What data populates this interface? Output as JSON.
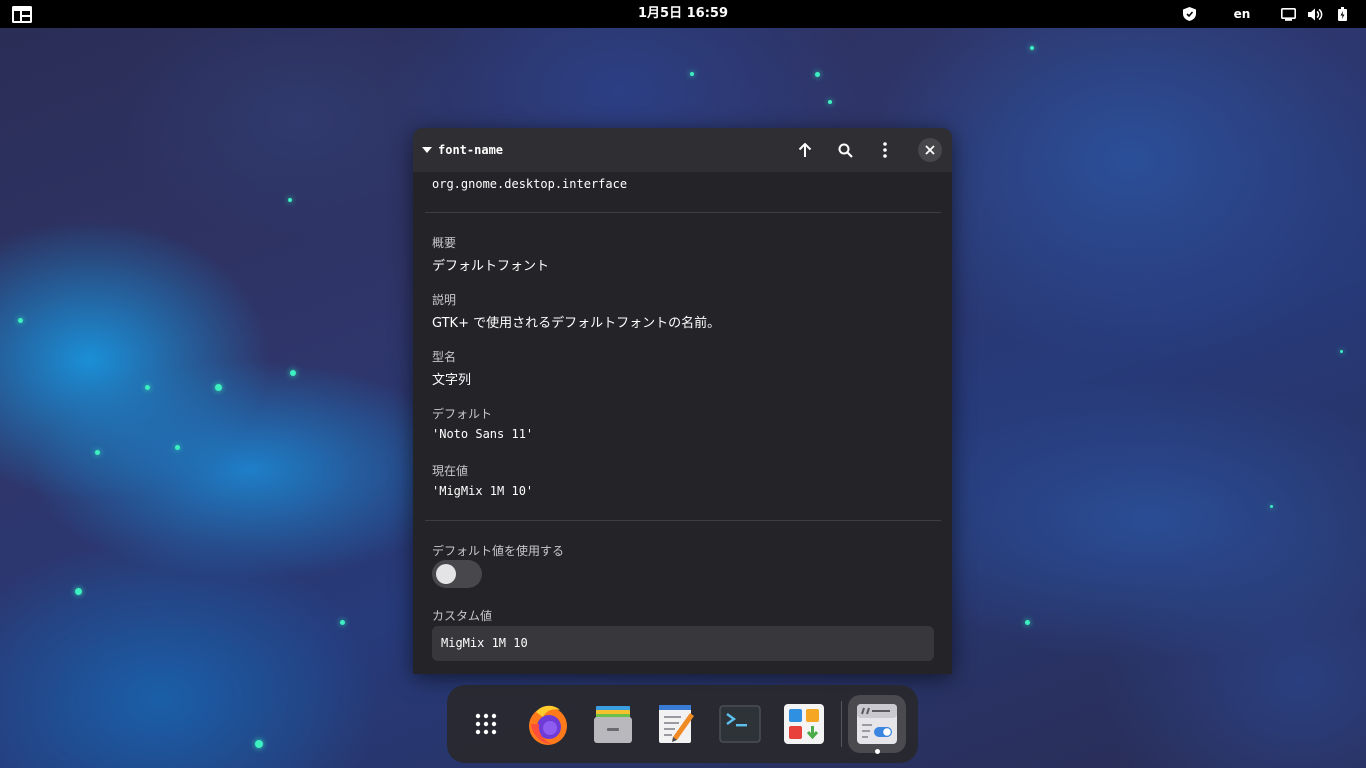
{
  "topbar": {
    "activities_icon": "activities-grid-icon",
    "clock": "1月5日 16:59",
    "tray": {
      "shield_icon": "shield-icon",
      "language": "en",
      "display_icon": "screen-icon",
      "volume_icon": "volume-icon",
      "battery_icon": "battery-charging-icon"
    }
  },
  "window": {
    "title": "font-name",
    "buttons": {
      "up_icon": "arrow-up-icon",
      "search_icon": "search-icon",
      "menu_icon": "kebab-menu-icon",
      "close_icon": "close-icon"
    },
    "schema_path": "org.gnome.desktop.interface",
    "summary_label": "概要",
    "summary_value": "デフォルトフォント",
    "description_label": "説明",
    "description_value": "GTK+ で使用されるデフォルトフォントの名前。",
    "type_label": "型名",
    "type_value": "文字列",
    "default_label": "デフォルト",
    "default_value": "'Noto Sans 11'",
    "current_label": "現在値",
    "current_value": "'MigMix 1M 10'",
    "use_default_label": "デフォルト値を使用する",
    "use_default_enabled": false,
    "custom_label": "カスタム値",
    "custom_value": "MigMix 1M 10"
  },
  "dock": {
    "items": [
      {
        "name": "app-grid",
        "icon": "app-grid-icon"
      },
      {
        "name": "firefox",
        "icon": "firefox-icon"
      },
      {
        "name": "files",
        "icon": "files-icon"
      },
      {
        "name": "text-editor",
        "icon": "text-editor-icon"
      },
      {
        "name": "terminal",
        "icon": "terminal-icon"
      },
      {
        "name": "software",
        "icon": "software-icon"
      },
      {
        "name": "dconf-editor",
        "icon": "dconf-editor-icon",
        "running": true
      }
    ]
  },
  "colors": {
    "topbar": "#000000",
    "window_bg": "#242428",
    "headerbar_bg": "#2f2f33",
    "accent_teal": "#3df0c0",
    "toggle_off": "#48484c"
  }
}
